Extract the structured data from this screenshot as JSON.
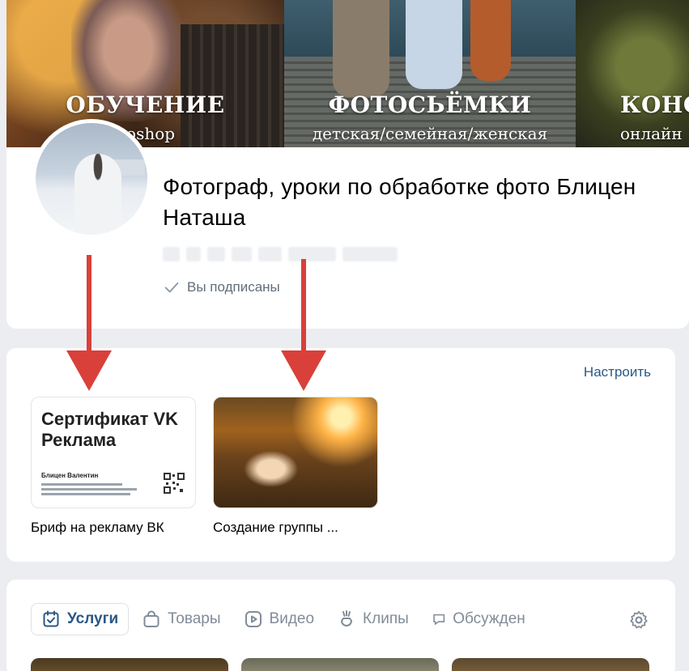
{
  "cover": {
    "panels": [
      {
        "title": "ОБУЧЕНИЕ",
        "subtitle": "toshop"
      },
      {
        "title": "ФОТОСЬЁМКИ",
        "subtitle": "детская/семейная/женская"
      },
      {
        "title": "КОНС",
        "subtitle": "онлайн"
      }
    ]
  },
  "profile": {
    "title": "Фотограф, уроки по обработке фото Блицен Наташа",
    "subscribed_label": "Вы подписаны"
  },
  "links": {
    "configure_label": "Настроить",
    "items": [
      {
        "caption": "Бриф на рекламу ВК",
        "thumb_title": "Сертификат VK Реклама",
        "thumb_name": "Блицен Валентин"
      },
      {
        "caption": "Создание группы ..."
      }
    ]
  },
  "tabs": [
    {
      "label": "Услуги",
      "icon": "calendar-check-icon",
      "active": true
    },
    {
      "label": "Товары",
      "icon": "shopping-bag-icon",
      "active": false
    },
    {
      "label": "Видео",
      "icon": "video-play-icon",
      "active": false
    },
    {
      "label": "Клипы",
      "icon": "clips-icon",
      "active": false
    },
    {
      "label": "Обсужден",
      "icon": "comments-icon",
      "active": false
    }
  ],
  "colors": {
    "accent": "#2a5885",
    "arrow": "#d9403a",
    "background": "#ebedf0",
    "muted": "#818c99"
  }
}
